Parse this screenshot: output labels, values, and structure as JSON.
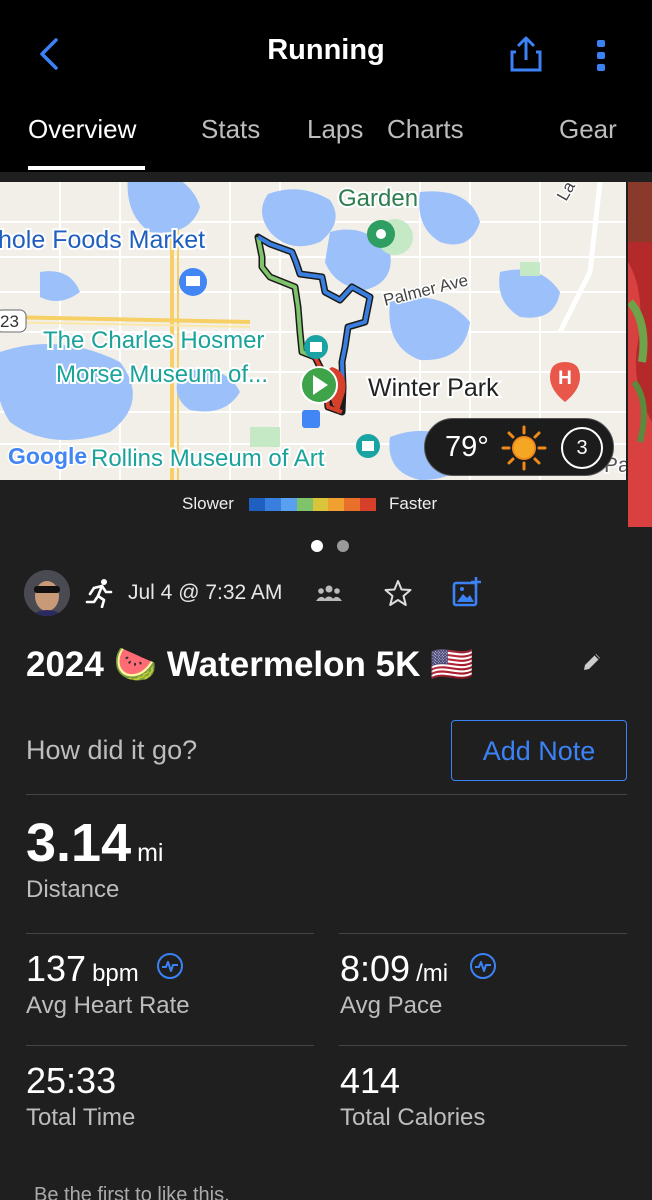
{
  "header": {
    "title": "Running",
    "tabs": [
      "Overview",
      "Stats",
      "Laps",
      "Charts",
      "Gear"
    ],
    "active_tab": "Overview",
    "accent_color": "#3b82f6"
  },
  "map": {
    "labels": {
      "garden": "Garden",
      "whole_foods": "hole Foods Market",
      "palmer": "Palmer Ave",
      "road_23": "23",
      "museum_line1": "The Charles Hosmer",
      "museum_line2": "Morse Museum of...",
      "winter_park": "Winter Park",
      "rollins": "Rollins Museum of Art",
      "google": "Google",
      "hospital_letter": "H",
      "pa": "Pa",
      "la": "La"
    },
    "weather": {
      "temperature": "79°",
      "condition_icon": "sun-icon",
      "laps": "3"
    }
  },
  "legend": {
    "slower": "Slower",
    "faster": "Faster",
    "colors": [
      "#1f5fbf",
      "#3a7fe0",
      "#5aa0f0",
      "#7fc36b",
      "#d9c43a",
      "#f0a030",
      "#e8702a",
      "#d6402a"
    ]
  },
  "carousel": {
    "count": 2,
    "active_index": 0
  },
  "activity": {
    "date": "Jul 4 @ 7:32 AM",
    "name": "2024 🍉 Watermelon 5K 🇺🇸",
    "note_prompt": "How did it go?",
    "add_note_label": "Add Note"
  },
  "stats": {
    "distance": {
      "value": "3.14",
      "unit": "mi",
      "label": "Distance"
    },
    "heart_rate": {
      "value": "137",
      "unit": "bpm",
      "label": "Avg Heart Rate"
    },
    "pace": {
      "value": "8:09",
      "unit": "/mi",
      "label": "Avg Pace"
    },
    "time": {
      "value": "25:33",
      "label": "Total Time"
    },
    "calories": {
      "value": "414",
      "label": "Total Calories"
    }
  },
  "likes_text": "Be the first to like this."
}
